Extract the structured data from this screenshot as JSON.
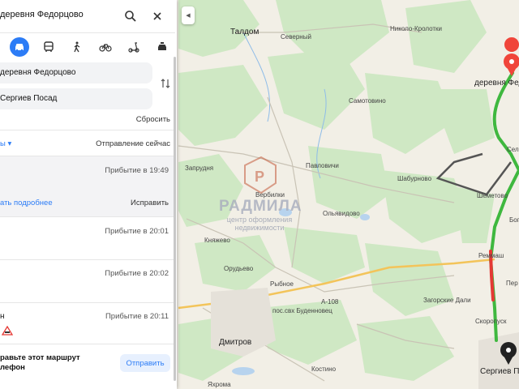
{
  "search": {
    "query": "деревня Федорцово"
  },
  "modes": [
    {
      "name": "car",
      "active": true
    },
    {
      "name": "transit"
    },
    {
      "name": "walk"
    },
    {
      "name": "bike"
    },
    {
      "name": "scooter"
    },
    {
      "name": "taxi"
    }
  ],
  "route_fields": {
    "from": "деревня Федорцово",
    "to": "Сергиев Посад"
  },
  "reset_label": "Сбросить",
  "options_label": "ы ▾",
  "departure_label": "Отправление сейчас",
  "routes": [
    {
      "arrival": "Прибытие в 19:49",
      "more": "ать подробнее",
      "fix": "Исправить"
    },
    {
      "arrival": "Прибытие в 20:01"
    },
    {
      "arrival": "Прибытие в 20:02"
    },
    {
      "arrival": "Прибытие в 20:11",
      "prefix": "н"
    }
  ],
  "send": {
    "line1": "равьте этот маршрут",
    "line2": "лефон",
    "button": "Отправить"
  },
  "watermark": {
    "title": "РАДМИЛА",
    "sub1": "центр оформления",
    "sub2": "недвижимости"
  },
  "colors": {
    "accent": "#2c7cf6",
    "route_green": "#3fb83f",
    "route_red": "#e53935",
    "forest": "#cfe8c4",
    "field": "#f2efe6"
  },
  "map_labels": {
    "taldom": "Талдом",
    "severny": "Северный",
    "nikolo": "Николо-Кролотки",
    "samotovino": "Самотовино",
    "fedortsovo": "деревня Федо",
    "zaprudnya": "Запрудня",
    "pavlovichi": "Павловичи",
    "shaburnovo": "Шабурново",
    "verbilki": "Вербилки",
    "olyavidovo": "Ольявидово",
    "shemetovo": "Шеметово",
    "knyazhevo": "Княжево",
    "remmash": "Реммаш",
    "orudyevo": "Орудьево",
    "rybnoe": "Рыбное",
    "a108": "А-108",
    "budennovets": "пос.свх Буденновец",
    "zagorskie": "Загорские Дали",
    "skoropusk": "Скоропуск",
    "dmitrov": "Дмитров",
    "kostino": "Костино",
    "sergiev": "Сергиев По",
    "yakhroma": "Яхрома",
    "sel": "Сел",
    "bog": "Бог",
    "per": "Пер"
  }
}
